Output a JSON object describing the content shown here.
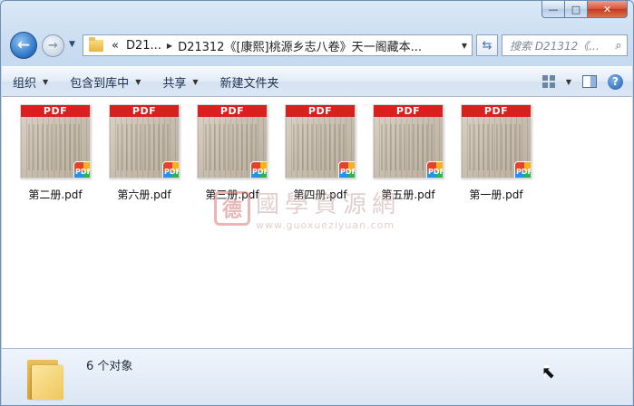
{
  "window": {
    "caption": {
      "min": "—",
      "max": "□",
      "close": "✕"
    }
  },
  "nav": {
    "back_glyph": "←",
    "forward_glyph": "→",
    "dropdown_glyph": "▼",
    "breadcrumb": {
      "overflow": "«",
      "parent": "D21...",
      "current": "D21312《[康熙]桃源乡志八卷》天一阁藏本..."
    },
    "search_placeholder": "搜索 D21312《...",
    "refresh_glyph": "⇆"
  },
  "toolbar": {
    "organize": "组织",
    "include_library": "包含到库中",
    "share": "共享",
    "new_folder": "新建文件夹",
    "help_glyph": "?"
  },
  "files": [
    {
      "name": "第二册.pdf",
      "badge": "PDF",
      "header": "PDF"
    },
    {
      "name": "第六册.pdf",
      "badge": "PDF",
      "header": "PDF"
    },
    {
      "name": "第三册.pdf",
      "badge": "PDF",
      "header": "PDF"
    },
    {
      "name": "第四册.pdf",
      "badge": "PDF",
      "header": "PDF"
    },
    {
      "name": "第五册.pdf",
      "badge": "PDF",
      "header": "PDF"
    },
    {
      "name": "第一册.pdf",
      "badge": "PDF",
      "header": "PDF"
    }
  ],
  "watermark": {
    "seal": "德",
    "cn": "國學資源網",
    "en": "www.guoxueziyuan.com"
  },
  "status": {
    "count_text": "6 个对象"
  },
  "colors": {
    "pdf_header": "#d8201f",
    "accent": "#2a6fc4"
  }
}
